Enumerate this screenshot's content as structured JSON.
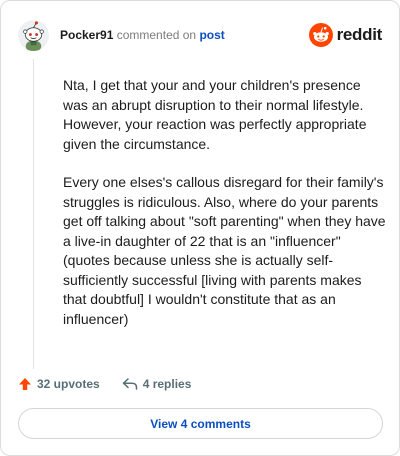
{
  "header": {
    "username": "Pocker91",
    "action_text": "commented on",
    "target_text": "post",
    "brand_name": "reddit"
  },
  "comment": {
    "paragraphs": [
      "Nta, I get that your and your children's presence was an abrupt disruption to their normal lifestyle. However, your reaction was perfectly appropriate given the circumstance.",
      "Every one elses's callous disregard for their family's struggles is ridiculous. Also, where do your parents get off talking about \"soft parenting\" when they have a live-in daughter of 22 that is an \"influencer\" (quotes because unless she is actually self-sufficiently successful [living with parents makes that doubtful] I wouldn't constitute that as an influencer)"
    ]
  },
  "actions": {
    "upvotes_label": "32 upvotes",
    "replies_label": "4 replies"
  },
  "view_comments_label": "View 4 comments",
  "icons": {
    "avatar": "snoo-avatar-icon",
    "brand": "reddit-logo-icon",
    "upvote": "upvote-arrow-icon",
    "reply": "reply-arrow-icon"
  },
  "colors": {
    "brand_orange": "#ff4500",
    "upvote": "#ff4500",
    "link_blue": "#0b4fbf",
    "muted_text": "#576f76"
  }
}
